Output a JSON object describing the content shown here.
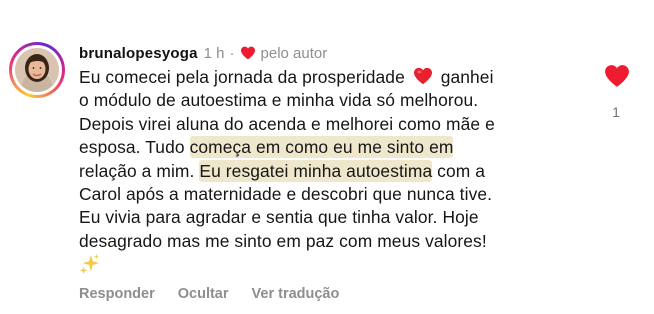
{
  "comment": {
    "username": "brunalopesyoga",
    "time": "1 h",
    "separator": "·",
    "author_label": "pelo autor",
    "text": {
      "line1_before_heart": "Eu comecei pela jornada da prosperidade",
      "line1_after_heart": "ganhei",
      "line2": "o módulo de autoestima e minha vida só melhorou.",
      "line3": "Depois virei aluna do acenda e melhorei como mãe e",
      "line4_plain": "esposa. Tudo ",
      "line4_highlight": "começa em como eu me sinto em",
      "line5_plain": "relação a mim. ",
      "line5_highlight": "Eu resgatei minha autoestima",
      "line5_tail": " com a",
      "line6": "Carol após a maternidade e descobri que nunca tive.",
      "line7": "Eu vivia para agradar e sentia que tinha valor. Hoje",
      "line8": "desagrado mas me sinto em paz com meus valores!"
    },
    "actions": {
      "reply": "Responder",
      "hide": "Ocultar",
      "translate": "Ver tradução"
    },
    "like_count": "1",
    "colors": {
      "heart": "#ed1c30",
      "highlight": "#efe7cc",
      "muted": "#8e8e8e"
    },
    "icons": {
      "author_heart": "heart-icon",
      "inline_heart": "red-heart-emoji",
      "sparkle": "sparkles-emoji",
      "like": "heart-icon"
    }
  }
}
